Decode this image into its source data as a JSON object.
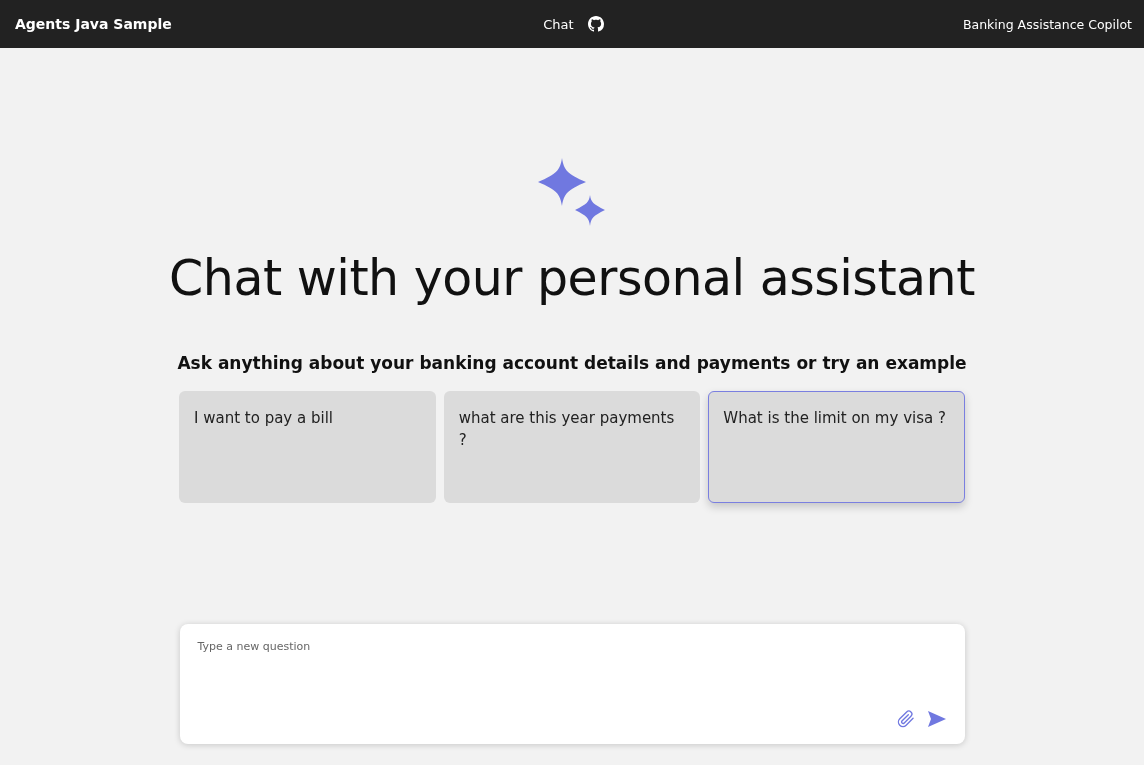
{
  "header": {
    "title": "Agents Java Sample",
    "nav": "Chat",
    "subtitle": "Banking Assistance Copilot"
  },
  "hero": {
    "title": "Chat with your personal assistant",
    "prompt": "Ask anything about your banking account details and payments or try an example"
  },
  "examples": [
    {
      "text": "I want to pay a bill",
      "selected": false
    },
    {
      "text": "what are this year payments ?",
      "selected": false
    },
    {
      "text": "What is the limit on my visa ?",
      "selected": true
    }
  ],
  "composer": {
    "placeholder": "Type a new question"
  }
}
